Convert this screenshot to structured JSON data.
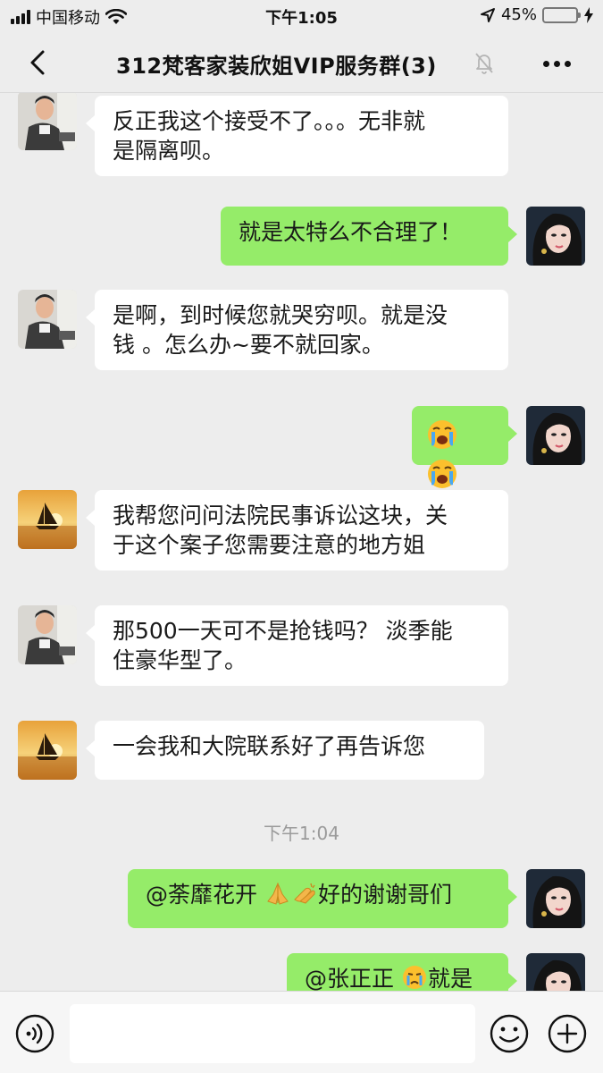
{
  "status": {
    "carrier": "中国移动",
    "time": "下午1:05",
    "battery": "45%",
    "battery_level": 0.45
  },
  "nav": {
    "title": "312梵客家装欣姐VIP服务群(3)"
  },
  "messages": [
    {
      "side": "in",
      "avatar": "man-avatar",
      "text_lines": [
        "反正我这个接受不了。。。无非就",
        "是隔离呗。"
      ]
    },
    {
      "side": "out",
      "avatar": "woman-avatar",
      "text": "就是太特么不合理了！"
    },
    {
      "side": "in",
      "avatar": "man-avatar",
      "text_lines": [
        "是啊，到时候您就哭穷呗。就是没",
        "钱 。怎么办~要不就回家。"
      ]
    },
    {
      "side": "out",
      "avatar": "woman-avatar",
      "emojis": [
        "loudly-crying-emoji",
        "loudly-crying-emoji"
      ]
    },
    {
      "side": "in",
      "avatar": "sailboat-avatar",
      "text_lines": [
        "我帮您问问法院民事诉讼这块，关",
        "于这个案子您需要注意的地方姐"
      ]
    },
    {
      "side": "in",
      "avatar": "man-avatar",
      "text_lines": [
        "那500一天可不是抢钱吗？ 淡季能",
        "住豪华型了。"
      ]
    },
    {
      "side": "in",
      "avatar": "sailboat-avatar",
      "text": "一会我和大院联系好了再告诉您"
    },
    {
      "side": "out",
      "avatar": "woman-avatar",
      "text_before": "@荼靡花开 ",
      "text_after": "好的谢谢哥们"
    },
    {
      "side": "out",
      "avatar": "woman-avatar",
      "text_before": "@张正正 ",
      "text_after": "就是"
    }
  ],
  "timestamp": "下午1:04",
  "colors": {
    "background": "#ededed",
    "outgoing_bubble": "#95ec69",
    "incoming_bubble": "#ffffff",
    "timestamp": "#9a9a9a"
  },
  "icons": {
    "back": "chevron-left-icon",
    "mute": "bell-off-icon",
    "more": "ellipsis-icon",
    "voice": "voice-input-icon",
    "emoji": "smiley-icon",
    "plus": "plus-icon"
  }
}
